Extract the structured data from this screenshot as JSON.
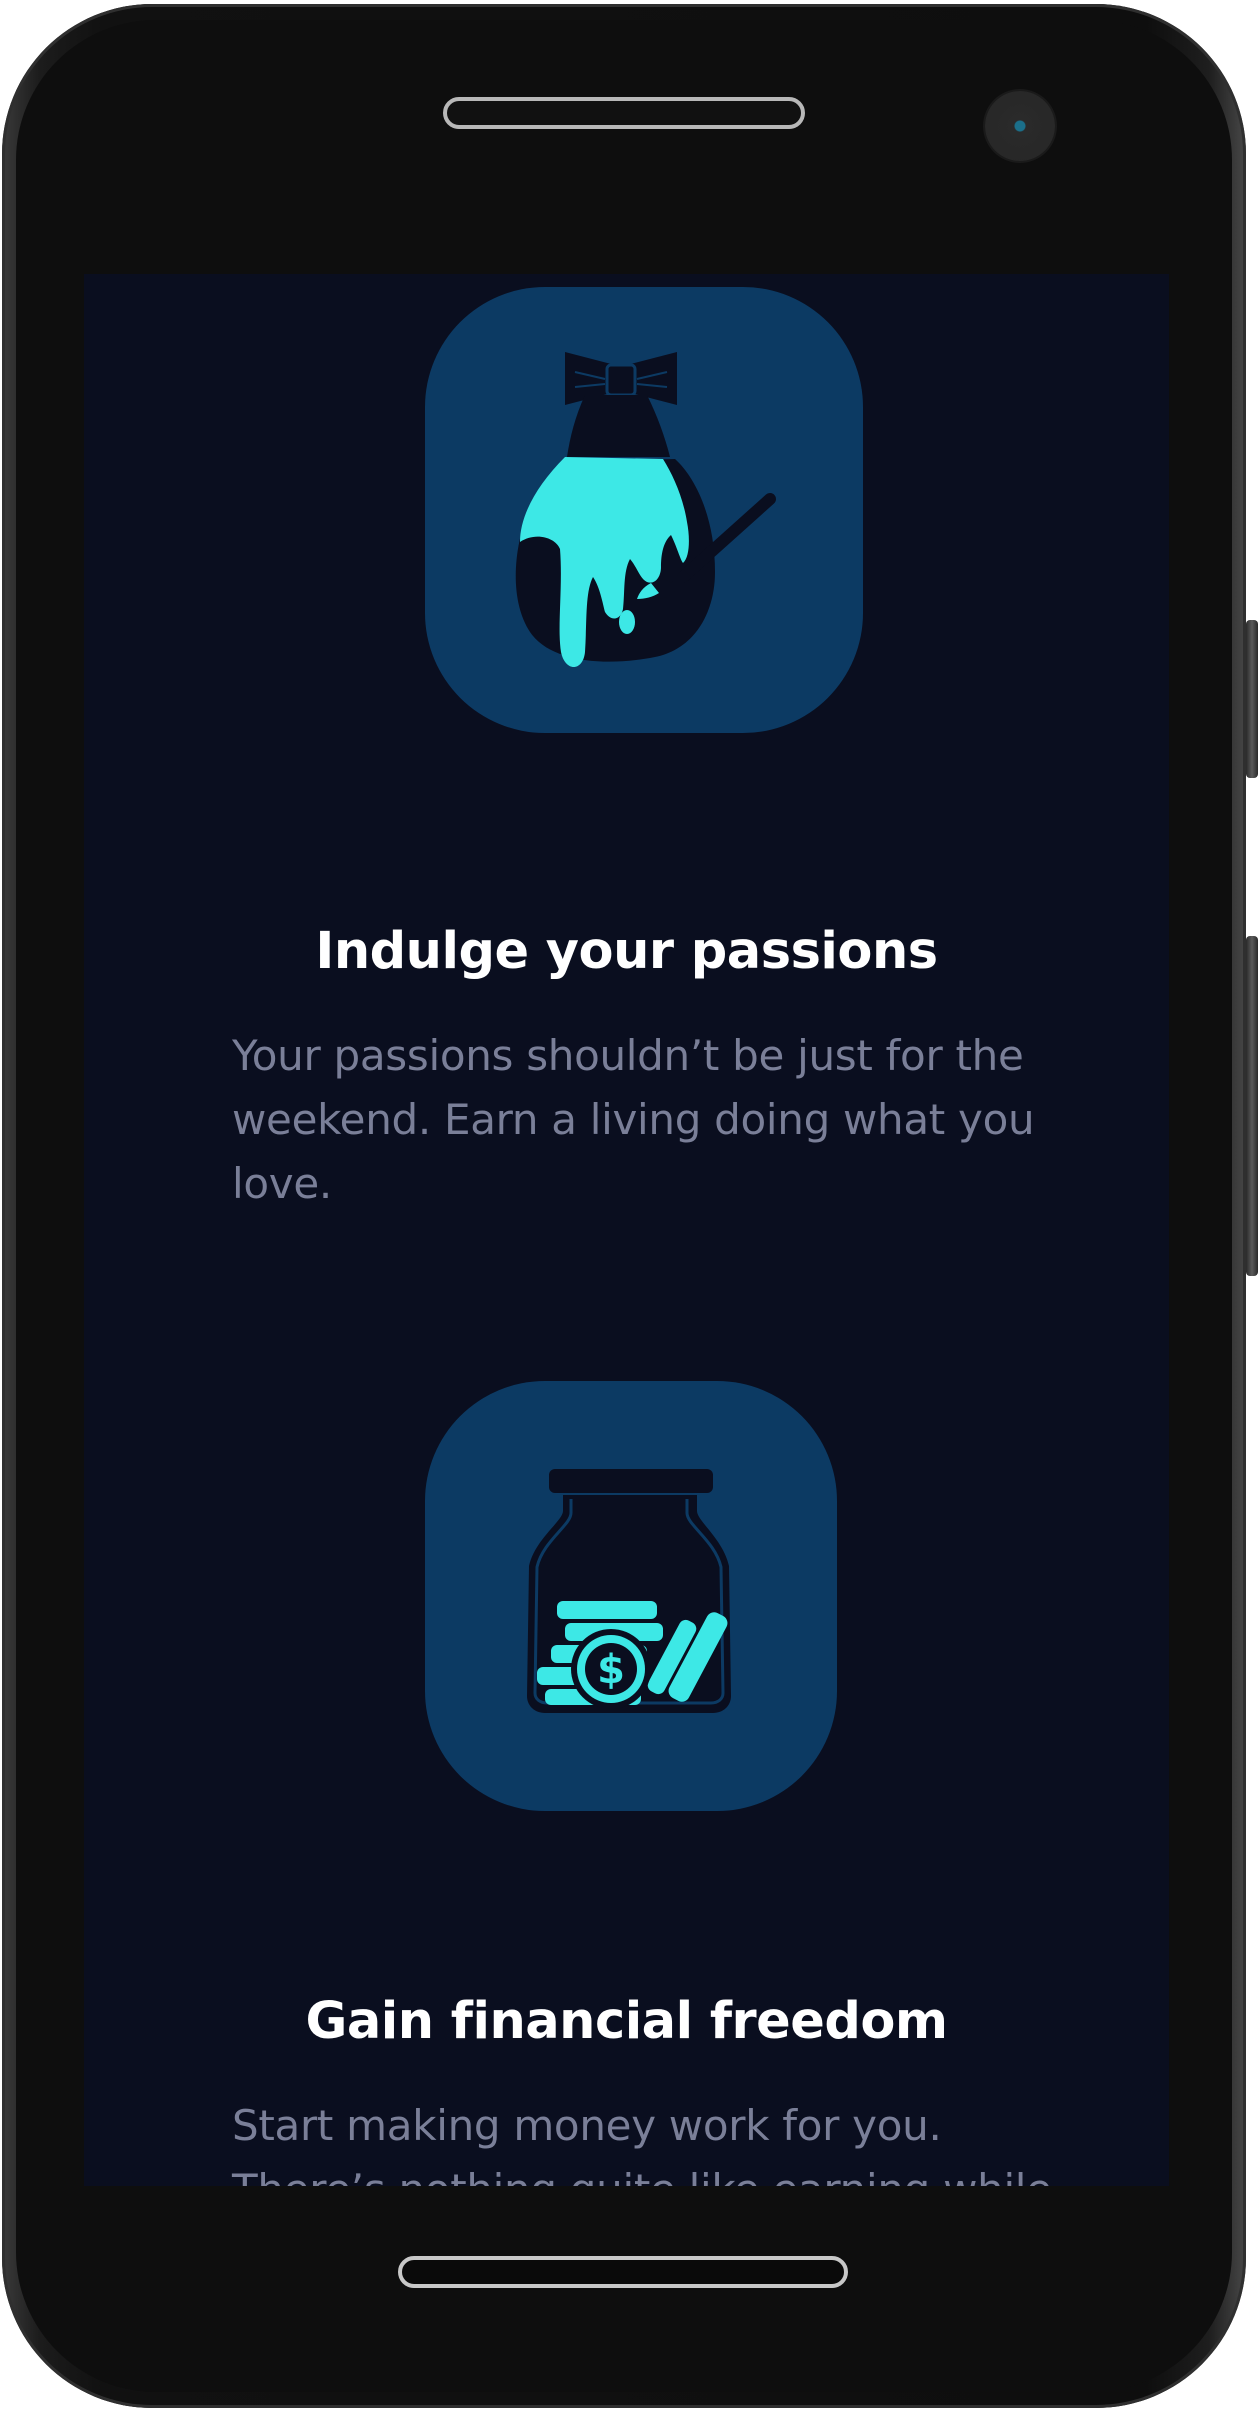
{
  "features": [
    {
      "icon": "paint-dripping-bag-icon",
      "title": "Indulge your passions",
      "description": "Your passions shouldn’t be just for the weekend. Earn a living doing what you love."
    },
    {
      "icon": "money-jar-icon",
      "title": "Gain financial freedom",
      "description": "Start making money work for you. There’s nothing quite like earning while"
    }
  ],
  "colors": {
    "screen_background": "#0a0e1f",
    "icon_tile": "#0c3a63",
    "accent_cyan": "#3de8e6",
    "title_text": "#ffffff",
    "description_text": "#7a7f98"
  }
}
